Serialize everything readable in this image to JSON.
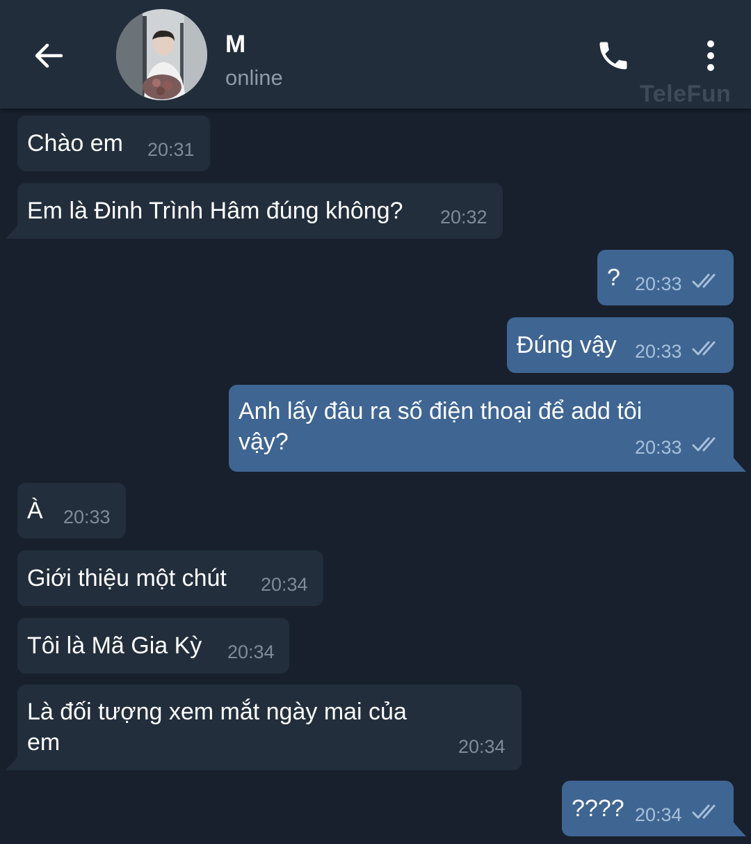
{
  "header": {
    "contact_name": "M",
    "status": "online",
    "watermark": "TeleFun"
  },
  "icons": {
    "back": "arrow-left-icon",
    "call": "phone-icon",
    "menu": "more-vertical-icon",
    "read": "double-check-icon"
  },
  "colors": {
    "background": "#18202d",
    "header": "#212d3b",
    "incoming_bubble": "#222e3c",
    "outgoing_bubble": "#3f6592"
  },
  "messages": [
    {
      "direction": "in",
      "text": "Chào em",
      "time": "20:31"
    },
    {
      "direction": "in",
      "text": "Em là Đinh Trình Hâm đúng không?",
      "time": "20:32"
    },
    {
      "direction": "out",
      "text": "?",
      "time": "20:33",
      "read": true
    },
    {
      "direction": "out",
      "text": "Đúng vậy",
      "time": "20:33",
      "read": true
    },
    {
      "direction": "out",
      "text": "Anh lấy đâu ra số điện thoại để add tôi\nvậy?",
      "time": "20:33",
      "read": true
    },
    {
      "direction": "in",
      "text": "À",
      "time": "20:33"
    },
    {
      "direction": "in",
      "text": "Giới thiệu một chút",
      "time": "20:34"
    },
    {
      "direction": "in",
      "text": "Tôi là Mã Gia Kỳ",
      "time": "20:34"
    },
    {
      "direction": "in",
      "text": "Là đối tượng xem mắt ngày mai của\nem",
      "time": "20:34"
    },
    {
      "direction": "out",
      "text": "????",
      "time": "20:34",
      "read": true
    }
  ]
}
